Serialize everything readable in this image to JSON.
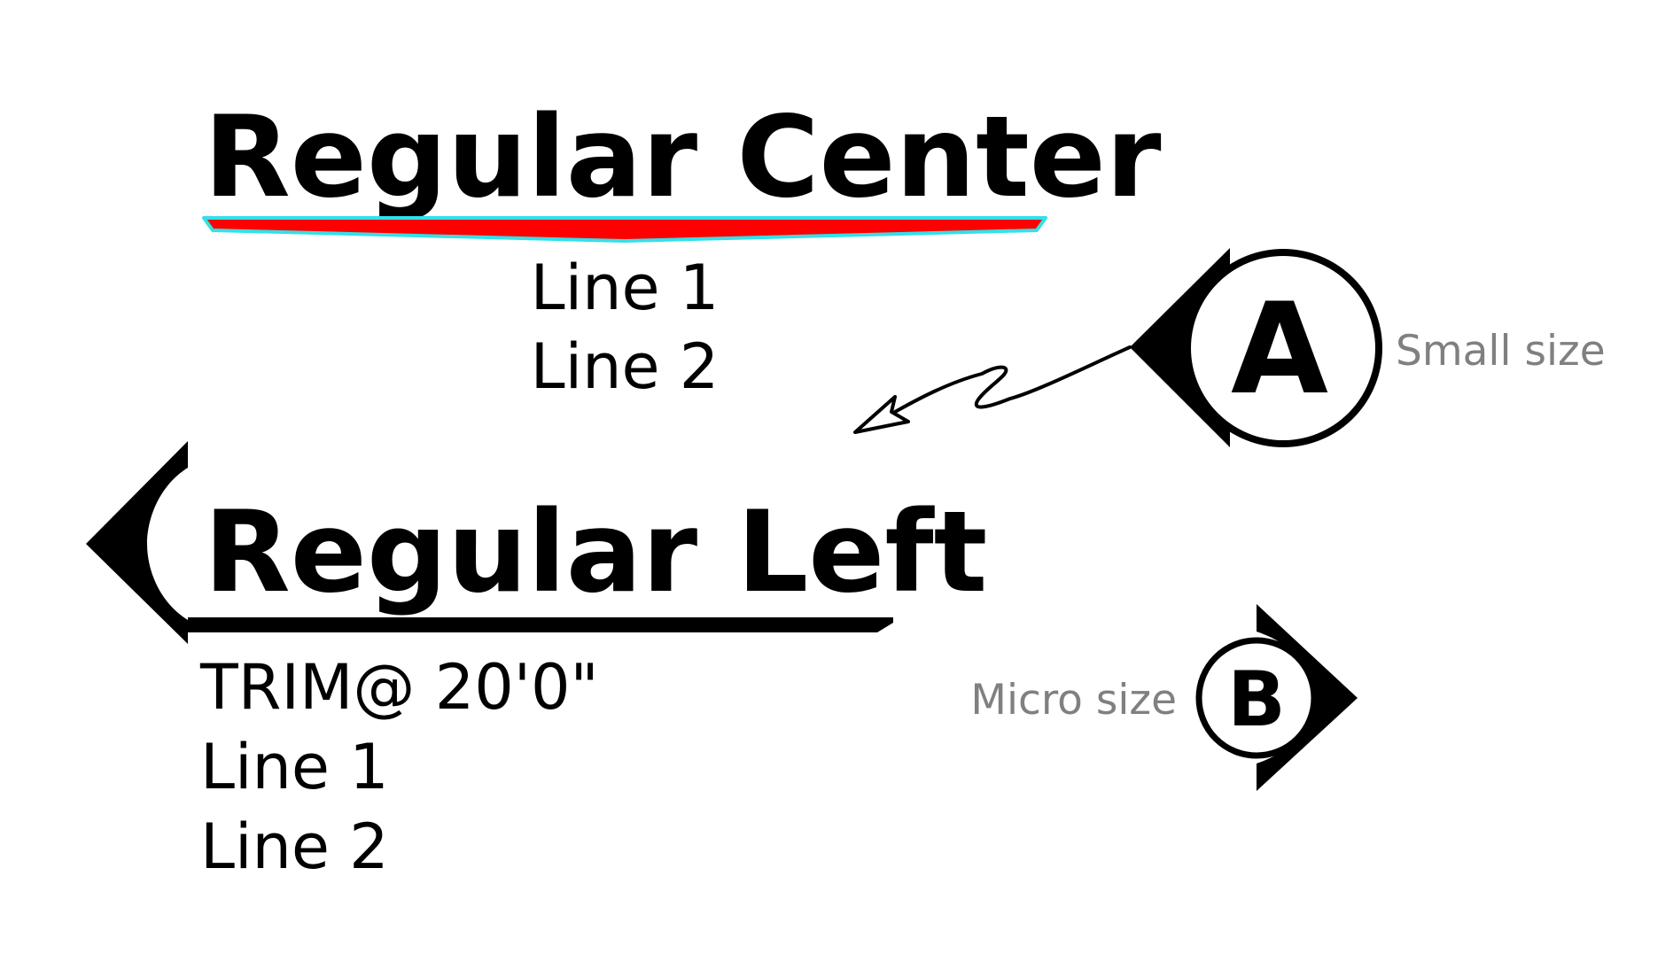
{
  "top_label": {
    "title": "Regular Center",
    "lines": [
      "Line 1",
      "Line 2"
    ],
    "underline_fill": "#ff0000",
    "underline_outline": "#33e0e8"
  },
  "left_label": {
    "title": "Regular Left",
    "lines": [
      "TRIM@ 20'0\"",
      "Line 1",
      "Line 2"
    ]
  },
  "callout_a": {
    "letter": "A",
    "size_label": "Small size"
  },
  "callout_b": {
    "letter": "B",
    "size_label": "Micro size"
  },
  "colors": {
    "ink": "#000000",
    "muted_text": "#808080",
    "background": "#ffffff"
  }
}
